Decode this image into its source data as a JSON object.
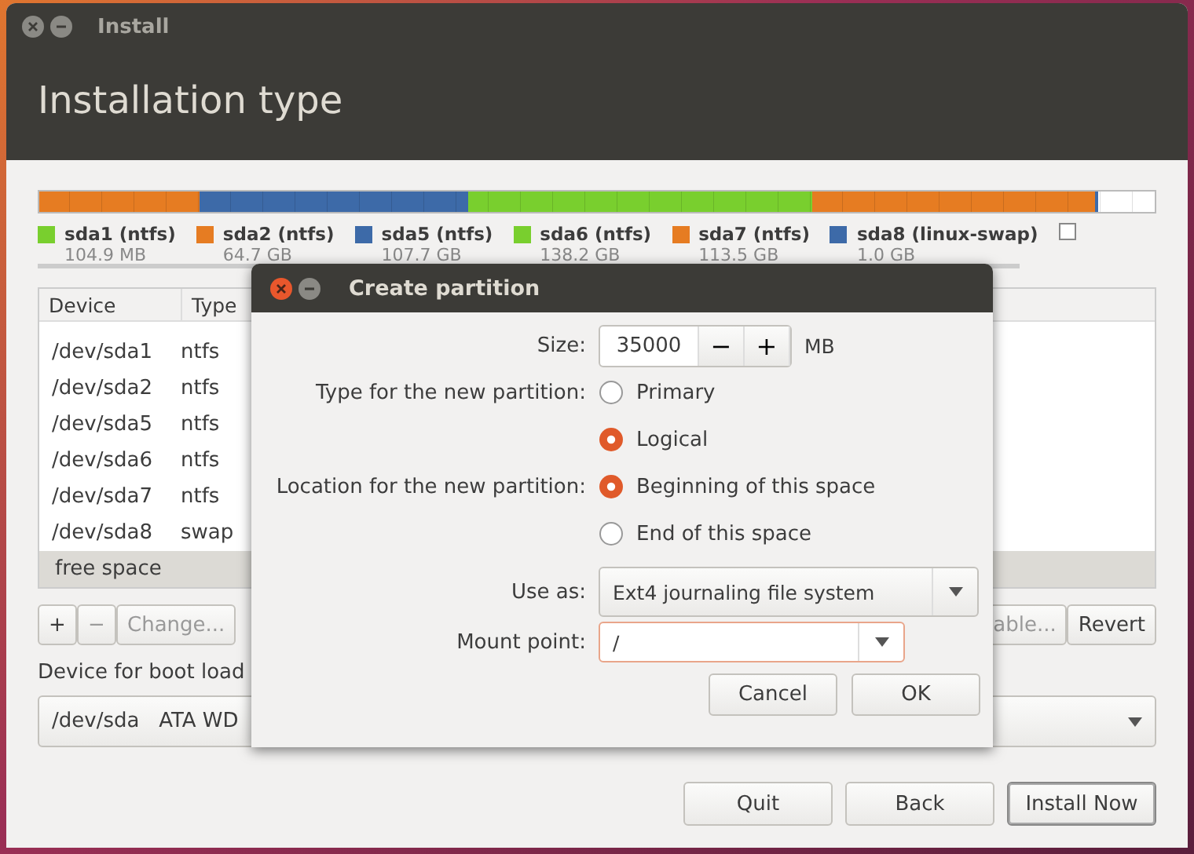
{
  "window": {
    "title": "Install",
    "heading": "Installation type"
  },
  "legend": [
    {
      "name": "sda1 (ntfs)",
      "size": "104.9 MB",
      "color": "#79cf2e"
    },
    {
      "name": "sda2 (ntfs)",
      "size": "64.7 GB",
      "color": "#e67c22"
    },
    {
      "name": "sda5 (ntfs)",
      "size": "107.7 GB",
      "color": "#3d6aa8"
    },
    {
      "name": "sda6 (ntfs)",
      "size": "138.2 GB",
      "color": "#79cf2e"
    },
    {
      "name": "sda7 (ntfs)",
      "size": "113.5 GB",
      "color": "#e67c22"
    },
    {
      "name": "sda8 (linux-swap)",
      "size": "1.0 GB",
      "color": "#3d6aa8"
    },
    {
      "color": "#ffffff"
    }
  ],
  "table": {
    "columns": [
      "Device",
      "Type"
    ],
    "rows": [
      {
        "device": "/dev/sda1",
        "type": "ntfs",
        "selected": false
      },
      {
        "device": "/dev/sda2",
        "type": "ntfs",
        "selected": false
      },
      {
        "device": "/dev/sda5",
        "type": "ntfs",
        "selected": false
      },
      {
        "device": "/dev/sda6",
        "type": "ntfs",
        "selected": false
      },
      {
        "device": "/dev/sda7",
        "type": "ntfs",
        "selected": false
      },
      {
        "device": "/dev/sda8",
        "type": "swap",
        "selected": false
      },
      {
        "device": "free space",
        "type": "",
        "selected": true
      }
    ]
  },
  "table_buttons": {
    "add": "+",
    "remove": "−",
    "change": "Change...",
    "new_table": "able...",
    "revert": "Revert"
  },
  "boot_loader": {
    "label": "Device for boot load",
    "value": "/dev/sda   ATA WD"
  },
  "buttons": [
    {
      "label": "Quit",
      "default": false
    },
    {
      "label": "Back",
      "default": false
    },
    {
      "label": "Install Now",
      "default": true
    }
  ],
  "dialog": {
    "title": "Create partition",
    "size": {
      "label": "Size:",
      "value": "35000",
      "minus": "−",
      "plus": "+",
      "unit": "MB"
    },
    "type": {
      "label": "Type for the new partition:",
      "options": [
        {
          "label": "Primary",
          "selected": false
        },
        {
          "label": "Logical",
          "selected": true
        }
      ]
    },
    "location": {
      "label": "Location for the new partition:",
      "options": [
        {
          "label": "Beginning of this space",
          "selected": true
        },
        {
          "label": "End of this space",
          "selected": false
        }
      ]
    },
    "use_as": {
      "label": "Use as:",
      "value": "Ext4 journaling file system"
    },
    "mount_point": {
      "label": "Mount point:",
      "value": "/"
    },
    "buttons": [
      "Cancel",
      "OK"
    ]
  }
}
